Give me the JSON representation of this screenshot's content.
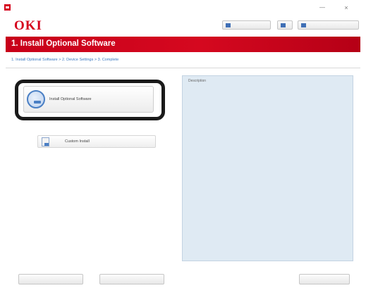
{
  "window": {
    "title": "",
    "minimize_glyph": "—",
    "close_glyph": "×"
  },
  "header": {
    "logo": "OKI",
    "subtitle": "",
    "buttons": [
      {
        "label": "",
        "icon": "help-icon"
      },
      {
        "label": "",
        "icon": "info-icon"
      },
      {
        "label": "",
        "icon": "document-icon"
      }
    ]
  },
  "banner": {
    "title": "1. Install Optional Software"
  },
  "breadcrumb": {
    "text": "1. Install Optional Software > 2. Device Settings > 3. Complete"
  },
  "options": {
    "install": {
      "label": "Install Optional Software",
      "icon": "install-disc-icon"
    },
    "custom": {
      "label": "Custom Install",
      "icon": "document-install-icon"
    }
  },
  "help_panel": {
    "heading": "Description",
    "text": ""
  },
  "footer": {
    "left_button": "",
    "middle_button": "",
    "right_button": ""
  },
  "colors": {
    "brand_red": "#d5001c",
    "banner_red": "#c8001a",
    "link_blue": "#3a78c0",
    "panel_bg": "#dfeaf3"
  }
}
